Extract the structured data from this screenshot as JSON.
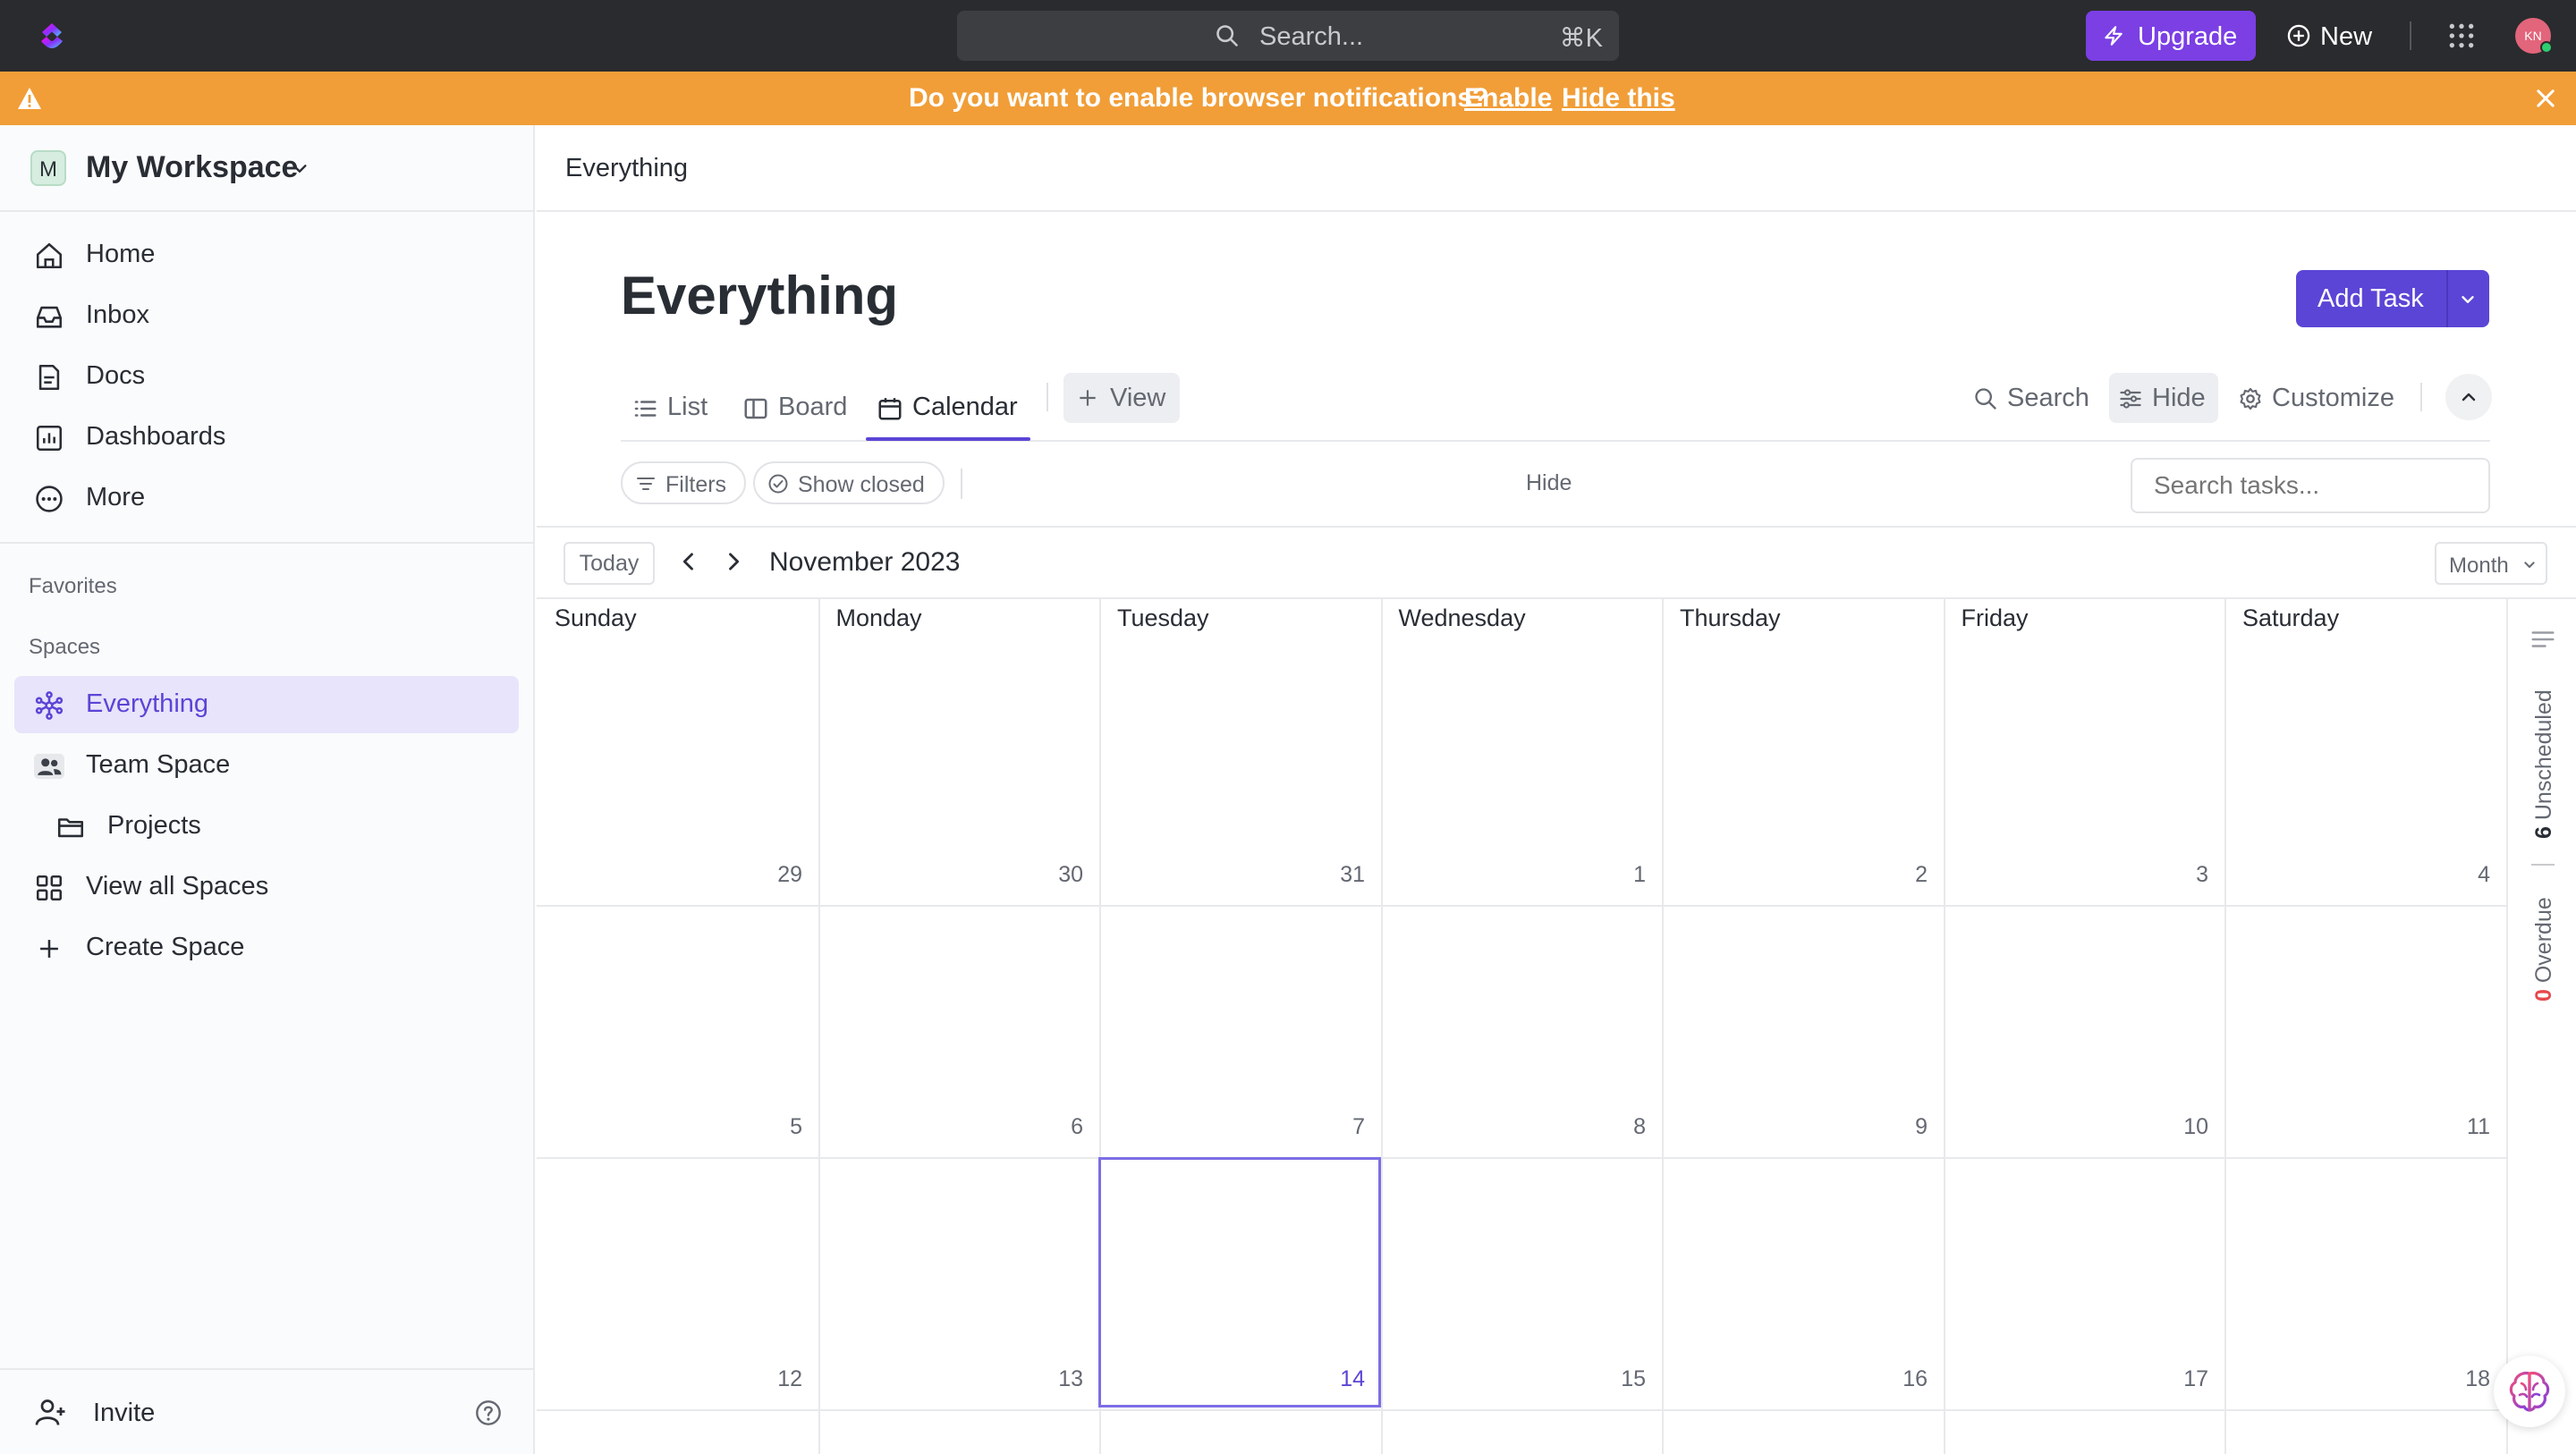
{
  "topbar": {
    "search_placeholder": "Search...",
    "search_shortcut": "⌘K",
    "upgrade_label": "Upgrade",
    "new_label": "New",
    "avatar_initials": "KN"
  },
  "banner": {
    "message": "Do you want to enable browser notifications?",
    "enable_label": "Enable",
    "hide_label": "Hide this"
  },
  "sidebar": {
    "workspace_badge": "M",
    "workspace_name": "My Workspace",
    "nav": [
      {
        "label": "Home",
        "icon": "home-icon"
      },
      {
        "label": "Inbox",
        "icon": "inbox-icon"
      },
      {
        "label": "Docs",
        "icon": "docs-icon"
      },
      {
        "label": "Dashboards",
        "icon": "dashboards-icon"
      },
      {
        "label": "More",
        "icon": "more-icon"
      }
    ],
    "favorites_label": "Favorites",
    "spaces_label": "Spaces",
    "spaces": [
      {
        "label": "Everything",
        "icon": "everything-icon",
        "active": true
      },
      {
        "label": "Team Space",
        "icon": "team-icon"
      },
      {
        "label": "Projects",
        "icon": "folder-icon"
      },
      {
        "label": "View all Spaces",
        "icon": "grid-icon"
      },
      {
        "label": "Create Space",
        "icon": "plus-icon"
      }
    ],
    "invite_label": "Invite"
  },
  "main": {
    "breadcrumb": "Everything",
    "title": "Everything",
    "add_task_label": "Add Task",
    "tabs": [
      {
        "label": "List",
        "icon": "list-icon"
      },
      {
        "label": "Board",
        "icon": "board-icon"
      },
      {
        "label": "Calendar",
        "icon": "calendar-icon",
        "active": true
      }
    ],
    "view_label": "View",
    "tools": {
      "search": "Search",
      "hide": "Hide",
      "customize": "Customize"
    },
    "filters": {
      "filters_label": "Filters",
      "show_closed_label": "Show closed",
      "hide_label": "Hide",
      "search_placeholder": "Search tasks..."
    }
  },
  "calendar": {
    "today_label": "Today",
    "month_label": "November 2023",
    "view_mode": "Month",
    "weekdays": [
      "Sunday",
      "Monday",
      "Tuesday",
      "Wednesday",
      "Thursday",
      "Friday",
      "Saturday"
    ],
    "weeks": [
      [
        "29",
        "30",
        "31",
        "1",
        "2",
        "3",
        "4"
      ],
      [
        "5",
        "6",
        "7",
        "8",
        "9",
        "10",
        "11"
      ],
      [
        "12",
        "13",
        "14",
        "15",
        "16",
        "17",
        "18"
      ]
    ],
    "today_date": "14",
    "unscheduled_count": "6",
    "unscheduled_label": "Unscheduled",
    "overdue_count": "0",
    "overdue_label": "Overdue"
  },
  "colors": {
    "accent": "#5b45d6",
    "banner": "#f19e38",
    "upgrade": "#7b3fe4",
    "topbar": "#2a2b2e"
  }
}
